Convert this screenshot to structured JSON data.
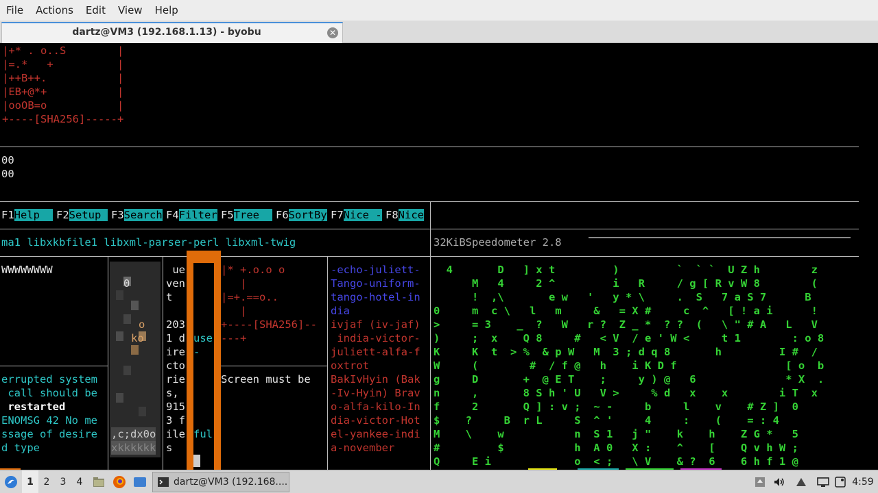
{
  "menubar": {
    "items": [
      "File",
      "Actions",
      "Edit",
      "View",
      "Help"
    ]
  },
  "tab": {
    "title": "dartz@VM3 (192.168.1.13) - byobu",
    "close_icon": "close-icon"
  },
  "terminal": {
    "randomart": [
      "|+* . o..S        |",
      "|=.*   +          |",
      "|++B++.           |",
      "|EB+@*+           |",
      "|ooOB=o           |",
      "+----[SHA256]-----+"
    ],
    "zeros": [
      "00",
      "00"
    ],
    "fkeys": [
      {
        "num": "F1",
        "label": "Help  "
      },
      {
        "num": "F2",
        "label": "Setup "
      },
      {
        "num": "F3",
        "label": "Search"
      },
      {
        "num": "F4",
        "label": "Filter"
      },
      {
        "num": "F5",
        "label": "Tree  "
      },
      {
        "num": "F6",
        "label": "SortBy"
      },
      {
        "num": "F7",
        "label": "Nice -"
      },
      {
        "num": "F8",
        "label": "Nice"
      }
    ],
    "pkg_line": "ma1 libxkbfile1 libxml-parser-perl libxml-twig",
    "speedometer": "32KiBSpeedometer 2.8",
    "pane1": {
      "top": "WWWWWWWW",
      "lines": [
        "errupted system",
        " call should be",
        " restarted",
        "ENOMSG 42 No me",
        "ssage of desire",
        "d type"
      ]
    },
    "pane2": {
      "top_glyph": "0",
      "lines": [
        "o",
        "ko"
      ],
      "bottom": [
        ",c;dx0o",
        "xkkkkkk"
      ]
    },
    "pane3": {
      "lines": [
        " ue",
        "ven",
        "t",
        "",
        "203",
        "1 d",
        "ire",
        "cto",
        "rie",
        "s,",
        "915",
        "3 f",
        "ile",
        "s"
      ],
      "right_lines": [
        "",
        "",
        "",
        "",
        "",
        "use",
        "-",
        "",
        "",
        "",
        "",
        "",
        "ful"
      ]
    },
    "pane4": {
      "art": [
        "|* +.o.o o",
        "   |",
        "|=+.==o..",
        "   |",
        "+----[SHA256]--",
        "---+"
      ],
      "screen_msg": "Screen must be"
    },
    "pane5": {
      "blue": [
        "-echo-juliett-",
        "Tango-uniform-",
        "tango-hotel-in",
        "dia"
      ],
      "red": [
        "ivjaf (iv-jaf)",
        " india-victor-",
        "juliett-alfa-f",
        "oxtrot",
        "BakIvHyin (Bak",
        "-Iv-Hyin) Brav",
        "o-alfa-kilo-In",
        "dia-victor-Hot",
        "el-yankee-indi",
        "a-november"
      ]
    },
    "matrix_rows": [
      "  4       D   ] x t         )         `  ` `  U Z h        z",
      "      M   4     2 ^         i   R     / g [ R v W 8        (",
      "      !  ,\\       e w   '   y * \\     .  S   7 a S 7      B",
      "0     m  c \\   l   m     &   = X #     c  ^   [ ! a i      !",
      ">     = 3    _  ?   W   r ?  Z _ *  ? ?  (   \\ \" # A   L   V",
      ")     ;  x    Q 8     #   < V  / e ' W <     t 1        : o 8",
      "K     K  t  > %  & p W   M  3 ; d q 8       h         I #  /",
      "W     (        #  / f @   h    i K D f                 [ o  b",
      "g     D       +  @ E T    ;     y ) @   6              * X  .",
      "n     ,       8 S h ' U   V >     % d   x    x        i T  x",
      "f     2       Q ] : v ;  ~ -     b     l    v    # Z ]  0",
      "$    ?     B  r L     S  ^ '     4     :    (    = : 4",
      "M    \\    w           n  S 1   j \"    k    h    Z G *   5",
      "#         $           h  A 0   X :    ^    [    Q v h W ;",
      "Q     E i             o  < ;   \\ V    & ?  6    6 h f 1 @"
    ]
  },
  "taskbar": {
    "workspaces": [
      "1",
      "2",
      "3",
      "4"
    ],
    "task_label": "dartz@VM3 (192.168....",
    "clock": "4:59",
    "icons": [
      "start-menu-icon",
      "files-icon",
      "firefox-icon",
      "desktop-icon",
      "terminal-icon",
      "upload-icon",
      "volume-icon",
      "network-icon",
      "notification-icon"
    ]
  },
  "colors": {
    "accent": "#17a6a6",
    "orange": "#e06c0a",
    "matrix": "#35d335",
    "red_text": "#c2352e",
    "cyan_text": "#2ec6c6"
  }
}
